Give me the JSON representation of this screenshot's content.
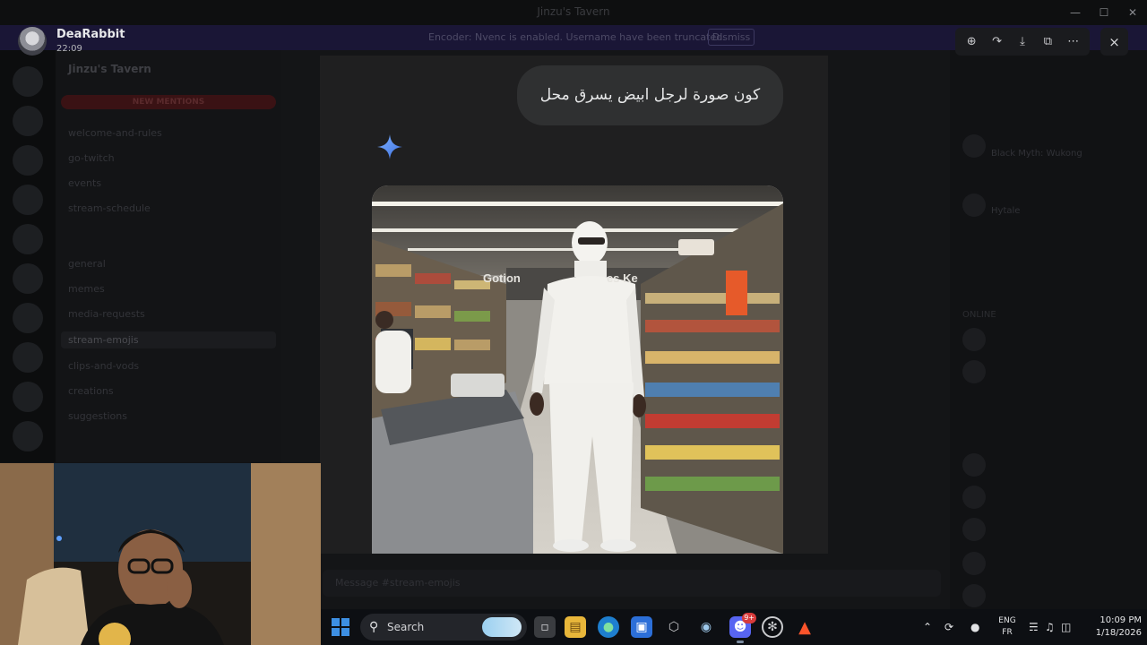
{
  "app": {
    "window_title": "Jinzu's Tavern"
  },
  "banner": {
    "text": "Encoder: Nvenc is enabled. Username have been truncated.",
    "button": "Dismiss"
  },
  "sidebar": {
    "server_name": "Jinzu's Tavern",
    "mentions_label": "NEW MENTIONS",
    "channels": [
      "welcome-and-rules",
      "go-twitch",
      "events",
      "stream-schedule",
      "general",
      "memes",
      "media-requests",
      "stream-emojis",
      "clips-and-vods",
      "creations",
      "suggestions"
    ],
    "active_channel": "stream-emojis"
  },
  "members": {
    "items": [
      "Black Myth: Wukong",
      "Hytale"
    ],
    "section": "ONLINE"
  },
  "viewer": {
    "username": "DeaRabbit",
    "time": "22:09",
    "toolbar": [
      "zoom-in-icon",
      "forward-icon",
      "download-icon",
      "open-external-icon",
      "more-icon"
    ],
    "close": "×"
  },
  "gemini": {
    "prompt": "كون صورة لرجل ابيض يسرق محل",
    "store_sign_left": "Gotion",
    "store_sign_right": "es Ke"
  },
  "message_bar": {
    "placeholder": "Message #stream-emojis"
  },
  "taskbar": {
    "search_label": "Search",
    "discord_badge": "9+",
    "lang_top": "ENG",
    "lang_bottom": "FR",
    "time": "10:09 PM",
    "date": "1/18/2026"
  },
  "colors": {
    "accent": "#3d8fe3",
    "gemini_star": "#4a86f0",
    "badge": "#d83b3b"
  }
}
